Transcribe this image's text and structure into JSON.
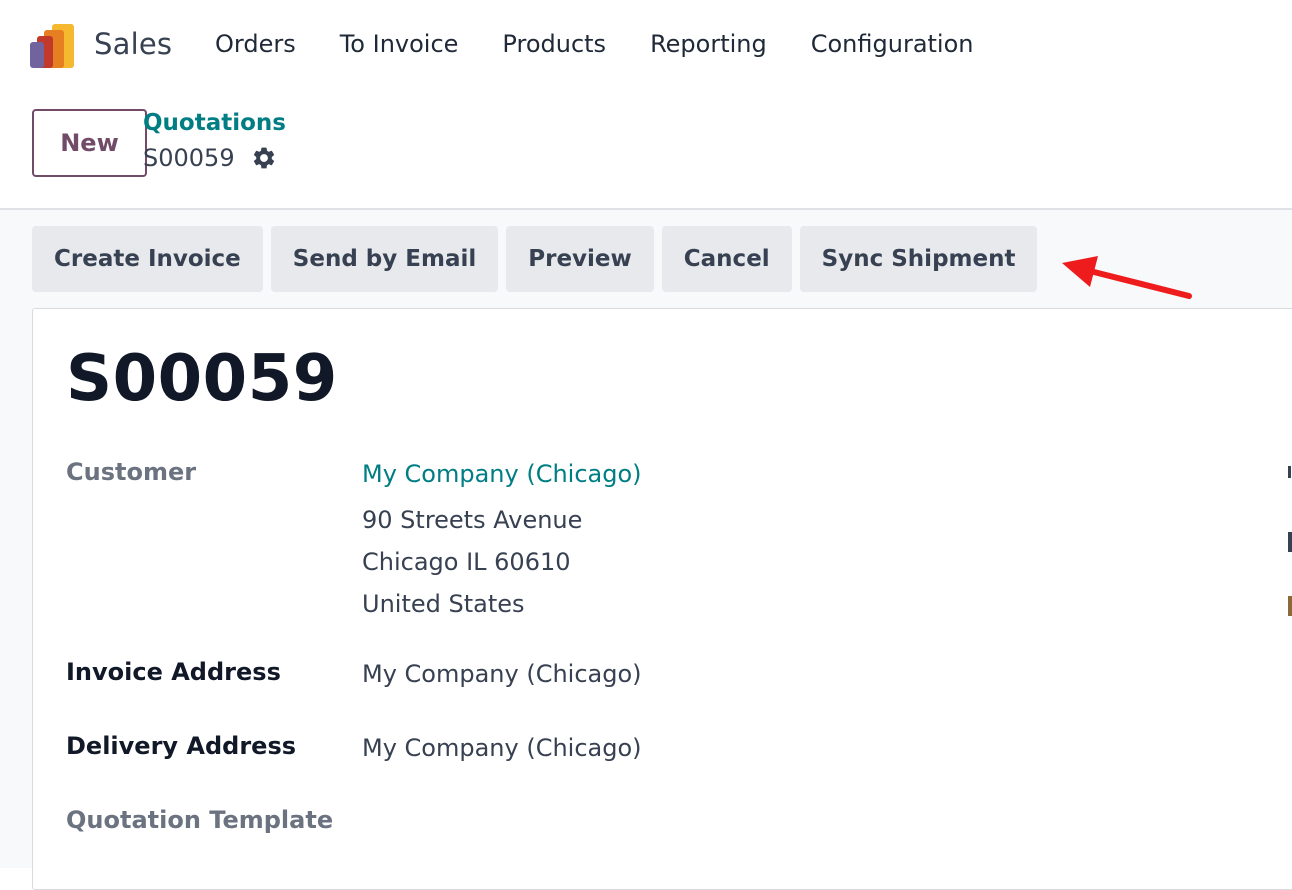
{
  "app": {
    "name": "Sales",
    "logo_colors": [
      "#71639e",
      "#c0392b",
      "#e67e22",
      "#f5b82e"
    ]
  },
  "nav": {
    "items": [
      "Orders",
      "To Invoice",
      "Products",
      "Reporting",
      "Configuration"
    ]
  },
  "control_panel": {
    "new_label": "New",
    "breadcrumb": "Quotations",
    "record_name": "S00059"
  },
  "actions": [
    "Create Invoice",
    "Send by Email",
    "Preview",
    "Cancel",
    "Sync Shipment"
  ],
  "form": {
    "title": "S00059",
    "customer": {
      "label": "Customer",
      "name": "My Company (Chicago)",
      "address_line1": "90 Streets Avenue",
      "address_line2": "Chicago IL 60610",
      "address_line3": "United States"
    },
    "invoice_address": {
      "label": "Invoice Address",
      "value": "My Company (Chicago)"
    },
    "delivery_address": {
      "label": "Delivery Address",
      "value": "My Company (Chicago)"
    },
    "quotation_template": {
      "label": "Quotation Template"
    }
  },
  "colors": {
    "brand": "#714b67",
    "link": "#017e84",
    "annotation_arrow": "#ee1c1c"
  }
}
